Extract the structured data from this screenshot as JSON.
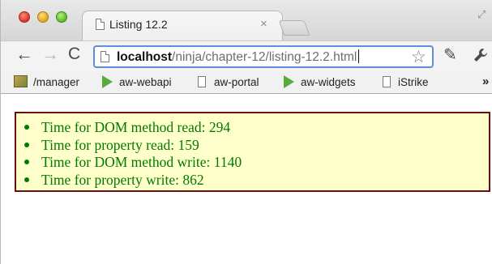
{
  "tab": {
    "title": "Listing 12.2",
    "close": "×"
  },
  "toolbar": {
    "back": "←",
    "forward": "→",
    "reload": "C",
    "url_host": "localhost",
    "url_path": "/ninja/chapter-12/listing-12.2.html",
    "star": "☆",
    "pen_icon": "✎",
    "wrench_icon": "🔧"
  },
  "bookmarks": [
    {
      "label": "/manager",
      "icon": "image-icon"
    },
    {
      "label": "aw-webapi",
      "icon": "play-icon"
    },
    {
      "label": "aw-portal",
      "icon": "page-icon"
    },
    {
      "label": "aw-widgets",
      "icon": "play-icon"
    },
    {
      "label": "iStrike",
      "icon": "page-icon"
    }
  ],
  "bookmarks_more": "»",
  "results": [
    "Time for DOM method read: 294",
    "Time for property read: 159",
    "Time for DOM method write: 1140",
    "Time for property write: 862"
  ],
  "colors": {
    "result_text": "#007a00",
    "box_background": "#ffffcc",
    "box_border": "#6b0d0d",
    "omnibox_focus": "#5d8fd8"
  }
}
